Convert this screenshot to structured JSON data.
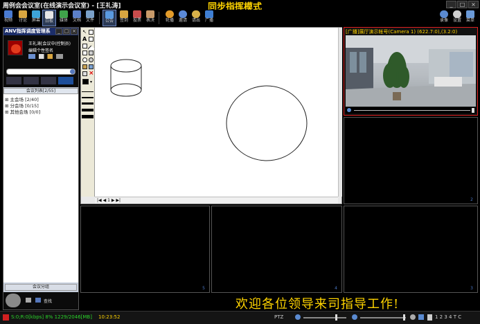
{
  "window": {
    "title": "周例会会议室(在线演示会议室) - [王礼涛]",
    "mode": "同步指挥模式"
  },
  "toolbar": {
    "items": [
      {
        "label": "视频",
        "icon": "video-icon"
      },
      {
        "label": "讨论",
        "icon": "discuss-icon"
      },
      {
        "label": "屏幕",
        "icon": "screen-icon"
      },
      {
        "label": "白板",
        "icon": "whiteboard-icon"
      },
      {
        "label": "媒体",
        "icon": "media-icon"
      },
      {
        "label": "文档",
        "icon": "document-icon"
      },
      {
        "label": "文件",
        "icon": "file-icon"
      },
      {
        "label": "公告",
        "icon": "notice-icon"
      },
      {
        "label": "签到",
        "icon": "checkin-icon"
      },
      {
        "label": "投票",
        "icon": "vote-icon"
      },
      {
        "label": "表决",
        "icon": "resolve-icon"
      },
      {
        "label": "轮播",
        "icon": "carousel-icon"
      },
      {
        "label": "邀请",
        "icon": "invite-icon"
      },
      {
        "label": "请出",
        "icon": "kickout-icon"
      },
      {
        "label": "广播",
        "icon": "broadcast-icon"
      },
      {
        "label": "录像",
        "icon": "record-icon"
      },
      {
        "label": "设置",
        "icon": "settings-icon"
      },
      {
        "label": "菜单",
        "icon": "menu-icon"
      }
    ]
  },
  "panel": {
    "title": "ANV指挥调度管理系",
    "user_name": "王礼涛[会议中(控制员)",
    "signature": "编辑个性签名",
    "list_header": "会议列表[2/55]",
    "tree": [
      {
        "label": "主会场 [2/40]"
      },
      {
        "label": "分会场 [0/15]"
      },
      {
        "label": "其他会场 [0/0]"
      }
    ],
    "group_button": "会议分组",
    "find_button": "查找"
  },
  "camera": {
    "label": "[广播]展厅演示帐号(Camera 1) (622.7:0),(3.2:0)"
  },
  "panes": [
    {
      "num": "2"
    },
    {
      "num": "5"
    },
    {
      "num": "4"
    },
    {
      "num": "3"
    }
  ],
  "whiteboard": {
    "page_nav": "1"
  },
  "banner": {
    "text": "欢迎各位领导来司指导工作!"
  },
  "status": {
    "traffic": "S:0;R:0[kbps] 8% 1229/2046[MB]",
    "time": "10:23:52",
    "ptz": "PTZ",
    "pages": "1 2 3 4 T C"
  },
  "colors": {
    "accent": "#ffd400",
    "active_border": "#e02020",
    "panel_title": "#1c2e6a"
  }
}
